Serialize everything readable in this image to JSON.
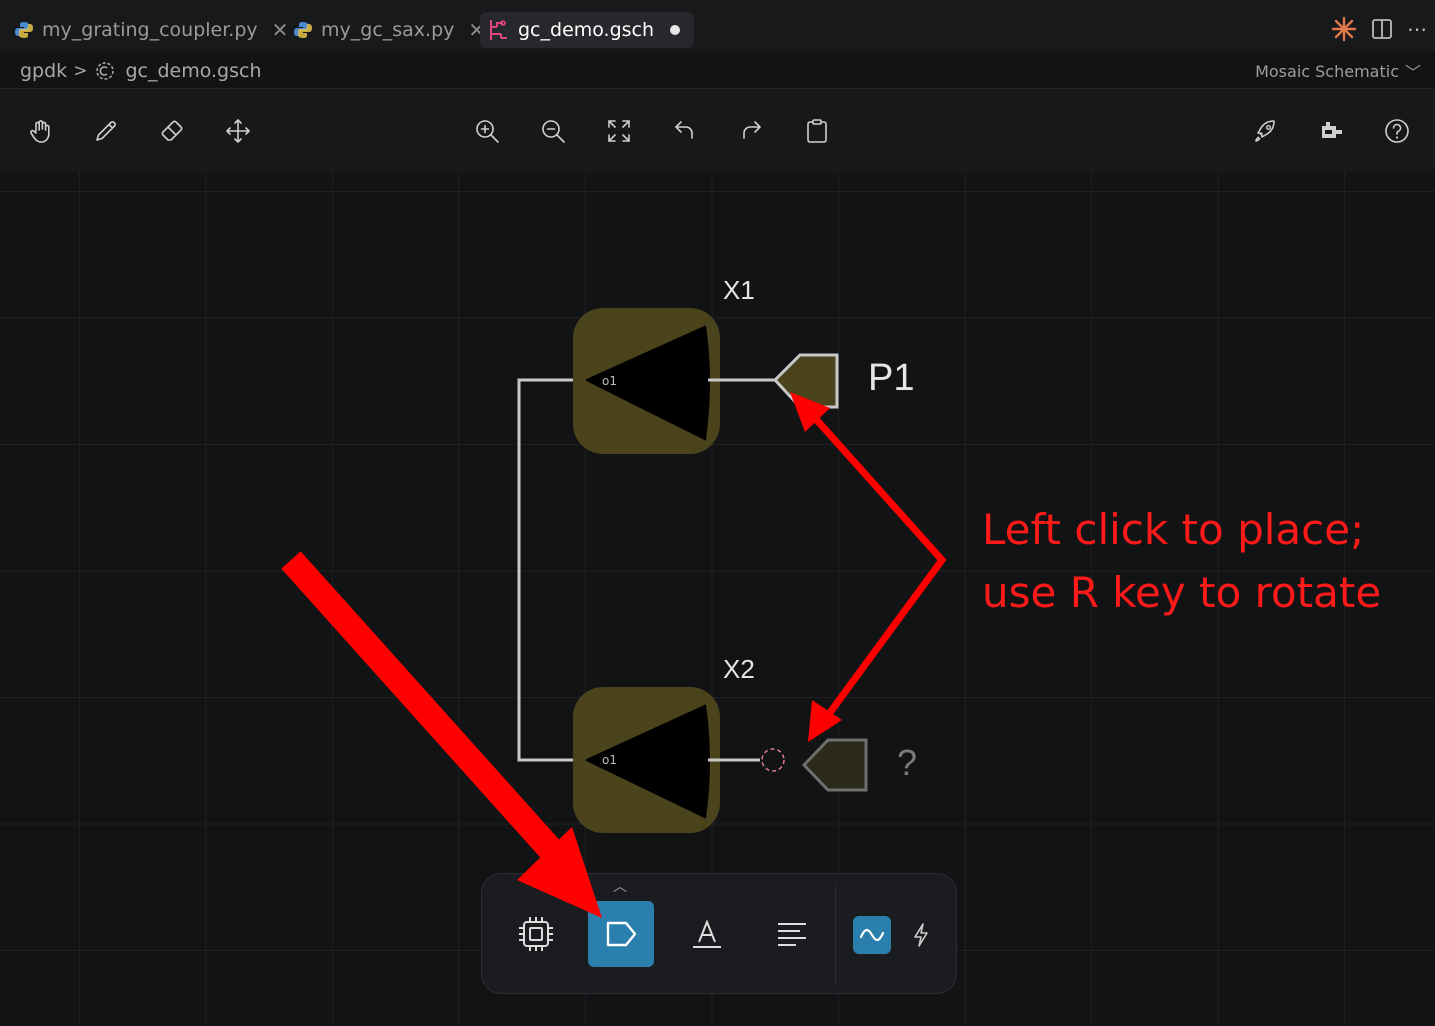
{
  "tabs": [
    {
      "label": "my_grating_coupler.py",
      "icon": "python-icon",
      "closable": true
    },
    {
      "label": "my_gc_sax.py",
      "icon": "python-icon",
      "closable": true
    },
    {
      "label": "gc_demo.gsch",
      "icon": "schematic-icon",
      "active": true,
      "modified": true
    }
  ],
  "breadcrumb": {
    "root": "gpdk",
    "file": "gc_demo.gsch"
  },
  "editor_mode": "Mosaic Schematic",
  "toolbar": {
    "left": [
      "hand-icon",
      "pencil-icon",
      "eraser-icon",
      "move-icon"
    ],
    "center": [
      "zoom-in-icon",
      "zoom-out-icon",
      "fit-view-icon",
      "undo-icon",
      "redo-icon",
      "clipboard-icon"
    ],
    "right": [
      "rocket-icon",
      "component-icon",
      "help-icon"
    ]
  },
  "schematic": {
    "instances": [
      {
        "label": "X1",
        "port_label": "o1"
      },
      {
        "label": "X2",
        "port_label": "o1"
      }
    ],
    "ports": [
      {
        "label": "P1"
      },
      {
        "label": "?"
      }
    ]
  },
  "annotation": {
    "line1": "Left click to place;",
    "line2": "use R key to rotate",
    "color": "#ff1a1a"
  },
  "palette": {
    "items": [
      "chip-icon",
      "port-icon",
      "text-icon",
      "align-icon"
    ],
    "active": "port-icon",
    "toggles": [
      "wave-icon",
      "bolt-icon"
    ]
  },
  "colors": {
    "background": "#121315",
    "component_fill": "#4a431c",
    "accent_blue": "#2a7fac",
    "wire": "#c8c8c8"
  }
}
